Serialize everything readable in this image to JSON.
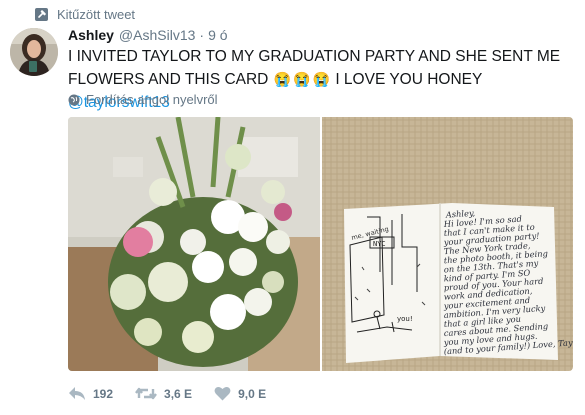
{
  "pinned": {
    "label": "Kitűzött tweet"
  },
  "tweet": {
    "name": "Ashley",
    "handle": "@AshSilv13",
    "separator": "·",
    "time": "9 ó",
    "text_part1": "I INVITED TAYLOR TO MY GRADUATION PARTY AND SHE SENT ME FLOWERS AND THIS CARD",
    "emojis": [
      "😭",
      "😭",
      "😭"
    ],
    "text_part2": " I LOVE YOU HONEY ",
    "mention": "@taylorswift13",
    "translate": "Fordítás angol nyelvről"
  },
  "actions": {
    "reply_count": "192",
    "retweet_count": "3,6 E",
    "like_count": "9,0 E"
  },
  "card": {
    "text_lines": [
      "Ashley,",
      "Hi love! I'm so sad",
      "that I can't make it to",
      "your graduation party!",
      "The New York trade,",
      "the photo booth, it being",
      "on the 13th. That's my",
      "kind of party. I'm SO",
      "proud of you. Your hard",
      "work and dedication,",
      "your excitement and",
      "ambition. I'm very lucky",
      "that a girl like you",
      "cares about me. Sending",
      "you my love and hugs.",
      "(and to your family!) Love, Taylor"
    ],
    "doodle_nyc": "NYC",
    "doodle_you": "you!",
    "doodle_me": "me, waiting"
  },
  "colors": {
    "text": "#14171a",
    "muted": "#657786",
    "link": "#1b95e0"
  },
  "icons": {
    "pinned": "pin-icon",
    "translate": "globe-icon",
    "reply": "reply-icon",
    "retweet": "retweet-icon",
    "like": "heart-icon"
  }
}
